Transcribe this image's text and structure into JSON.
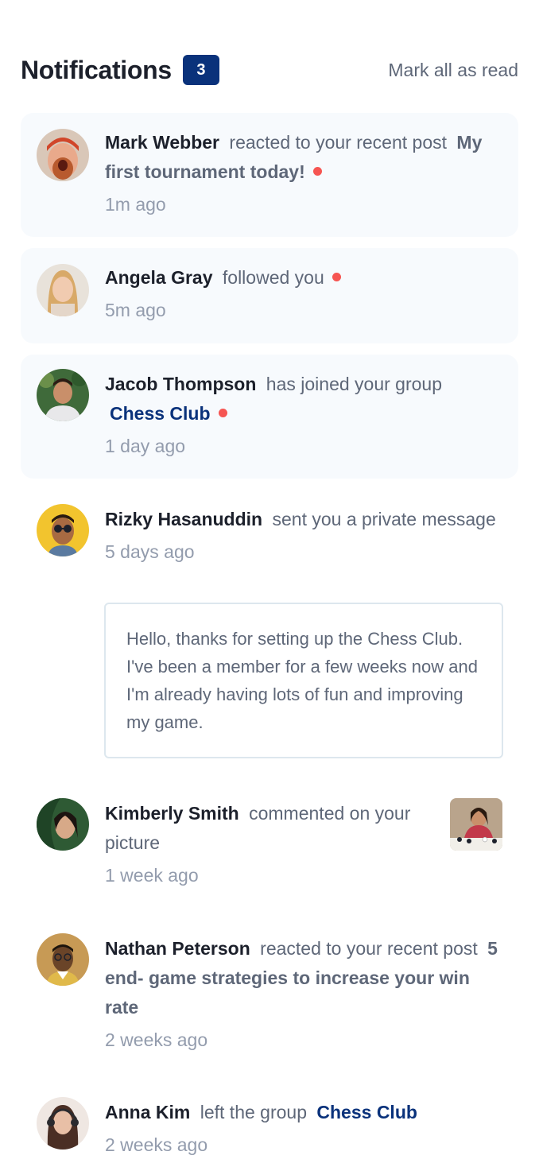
{
  "header": {
    "title": "Notifications",
    "unread_count": "3",
    "mark_all_label": "Mark all as read"
  },
  "notifications": [
    {
      "user": "Mark Webber",
      "action": "reacted to your recent post",
      "post": "My first tournament today!",
      "time": "1m ago",
      "unread": true
    },
    {
      "user": "Angela Gray",
      "action": "followed you",
      "time": "5m ago",
      "unread": true
    },
    {
      "user": "Jacob Thompson",
      "action": "has joined your group",
      "group": "Chess Club",
      "time": "1 day ago",
      "unread": true
    },
    {
      "user": "Rizky Hasanuddin",
      "action": "sent you a private message",
      "time": "5 days ago",
      "message": "Hello, thanks for setting up the Chess Club. I've been a member for a few weeks now and I'm already having lots of fun and improving my game.",
      "unread": false
    },
    {
      "user": "Kimberly Smith",
      "action": "commented on your picture",
      "time": "1 week ago",
      "unread": false
    },
    {
      "user": "Nathan Peterson",
      "action": "reacted to your recent post",
      "post": "5 end- game strategies to increase your win rate",
      "time": "2 weeks ago",
      "unread": false
    },
    {
      "user": "Anna Kim",
      "action": "left the group",
      "group": "Chess Club",
      "time": "2 weeks ago",
      "unread": false
    }
  ],
  "colors": {
    "accent": "#0a327b",
    "unread_dot": "#f65552",
    "unread_bg": "#f7fafd"
  }
}
